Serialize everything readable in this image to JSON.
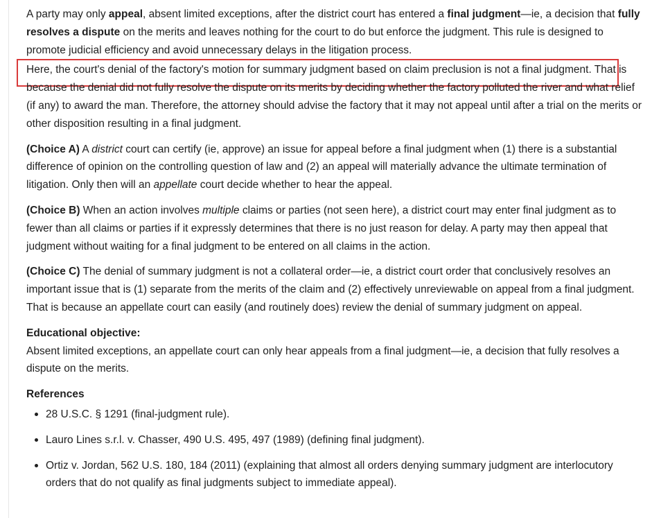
{
  "para1": {
    "t1": "A party may only ",
    "b1": "appeal",
    "t2": ", absent limited exceptions, after the district court has entered a ",
    "b2": "final judgment",
    "t3": "—ie, a decision that ",
    "b3": "fully resolves a dispute",
    "t4": " on the merits and leaves nothing for the court to do but enforce the judgment.  This rule is designed to promote judicial efficiency and avoid unnecessary delays in the litigation process."
  },
  "para2": {
    "highlighted": "Here, the court's denial of the factory's motion for summary judgment based on claim preclusion is not a final judgment.",
    "rest": " That is because the denial did not fully resolve the dispute on its merits by deciding whether the factory polluted the river and what relief (if any) to award the man.  Therefore, the attorney should advise the factory that it may not appeal until after a trial on the merits or other disposition resulting in a final judgment."
  },
  "choice_a": {
    "label": "(Choice A)",
    "t1": " A ",
    "i1": "district",
    "t2": " court can certify (ie, approve) an issue for appeal before a final judgment when (1) there is a substantial difference of opinion on the controlling question of law and (2) an appeal will materially advance the ultimate termination of litigation.  Only then will an ",
    "i2": "appellate",
    "t3": " court decide whether to hear the appeal."
  },
  "choice_b": {
    "label": "(Choice B)",
    "t1": " When an action involves ",
    "i1": "multiple",
    "t2": " claims or parties (not seen here), a district court may enter final judgment as to fewer than all claims or parties if it expressly determines that there is no just reason for delay.  A party may then appeal that judgment without waiting for a final judgment to be entered on all claims in the action."
  },
  "choice_c": {
    "label": "(Choice C)",
    "t1": " The denial of summary judgment is not a collateral order—ie, a district court order that conclusively resolves an important issue that is (1) separate from the merits of the claim and (2) effectively unreviewable on appeal from a final judgment.  That is because an appellate court can easily (and routinely does) review the denial of summary judgment on appeal."
  },
  "objective": {
    "title": "Educational objective:",
    "text": "Absent limited exceptions, an appellate court can only hear appeals from a final judgment—ie, a decision that fully resolves a dispute on the merits."
  },
  "references": {
    "title": "References",
    "items": [
      "28 U.S.C. § 1291 (final-judgment rule).",
      "Lauro Lines s.r.l. v. Chasser, 490 U.S. 495, 497 (1989) (defining final judgment).",
      "Ortiz v. Jordan, 562 U.S. 180, 184 (2011) (explaining that almost all orders denying summary judgment are interlocutory orders that do not qualify as final judgments subject to immediate appeal)."
    ]
  },
  "colors": {
    "highlight_border": "#d93a3a",
    "text": "#1f1f1f"
  }
}
